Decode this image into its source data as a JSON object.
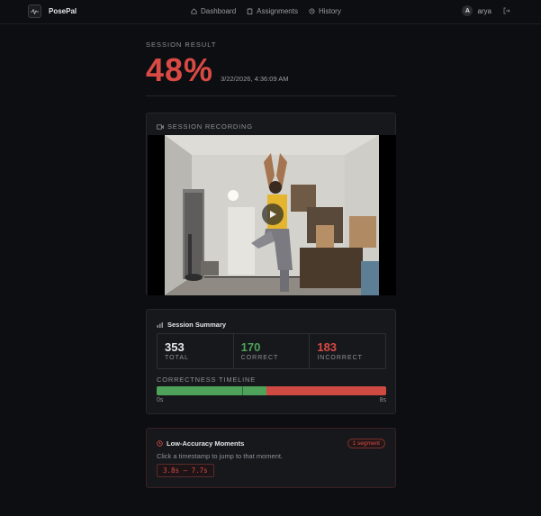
{
  "header": {
    "brand": "PosePal",
    "nav": [
      {
        "label": "Dashboard",
        "icon": "home-icon"
      },
      {
        "label": "Assignments",
        "icon": "clipboard-icon"
      },
      {
        "label": "History",
        "icon": "history-icon"
      }
    ],
    "user": {
      "initial": "A",
      "name": "arya"
    }
  },
  "result": {
    "label": "SESSION RESULT",
    "score": "48%",
    "date": "3/22/2026, 4:36:09 AM"
  },
  "recording": {
    "title": "SESSION RECORDING"
  },
  "summary": {
    "title": "Session Summary",
    "stats": [
      {
        "value": "353",
        "label": "TOTAL",
        "color": "#e8e8e8"
      },
      {
        "value": "170",
        "label": "CORRECT",
        "color": "#4fa25a"
      },
      {
        "value": "183",
        "label": "INCORRECT",
        "color": "#d94a45"
      }
    ],
    "timeline_label": "CORRECTNESS TIMELINE",
    "timeline_correct_fraction": 0.48,
    "timeline_start": "0s",
    "timeline_end": "8s"
  },
  "low_accuracy": {
    "title": "Low-Accuracy Moments",
    "badge": "1 segment",
    "description": "Click a timestamp to jump to that moment.",
    "segments": [
      "3.8s – 7.7s"
    ]
  },
  "colors": {
    "accent_red": "#d94a45",
    "accent_green": "#4fa25a",
    "background": "#0d0e11"
  }
}
